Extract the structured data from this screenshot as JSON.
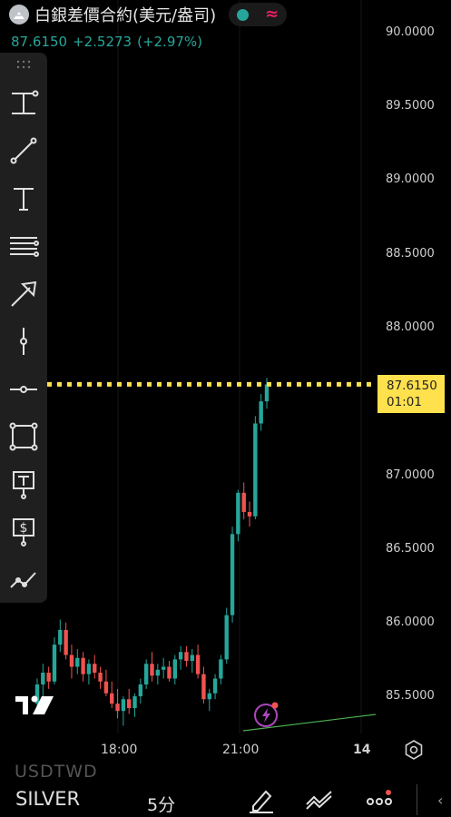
{
  "header": {
    "title": "白銀差價合約(美元/盎司)",
    "symbol_icon": "silver-coin-icon",
    "status_icon": "market-open-dot-icon",
    "status_icon_2": "wave-icon",
    "wave_glyph": "≈"
  },
  "quote": {
    "last": "87.6150",
    "change": "+2.5273",
    "change_pct": "(+2.97%)",
    "color_up": "#26a69a",
    "color_down": "#ef5350"
  },
  "toolbar": {
    "tools": [
      "cross-line-tool-icon",
      "trend-line-icon",
      "text-tool-icon",
      "horizontal-lines-icon",
      "arrow-tool-icon",
      "vertical-line-icon",
      "horizontal-ray-icon",
      "rectangle-tool-icon",
      "text-note-icon",
      "price-label-icon",
      "path-tool-icon"
    ]
  },
  "price_axis": {
    "labels": [
      "90.0000",
      "89.5000",
      "89.0000",
      "88.5000",
      "88.0000",
      "87.0000",
      "86.5000",
      "86.0000",
      "85.5000"
    ],
    "current_price": "87.6150",
    "countdown": "01:01",
    "current_color": "#ffe14d"
  },
  "time_axis": {
    "labels": [
      "18:00",
      "21:00",
      "14"
    ]
  },
  "chart_data": {
    "type": "candlestick",
    "ylim": [
      85.2,
      90.1
    ],
    "x_ticks": [
      "18:00",
      "21:00",
      "14"
    ],
    "last": 87.615,
    "candles": [
      [
        85.45,
        85.62,
        85.38,
        85.58
      ],
      [
        85.58,
        85.72,
        85.5,
        85.66
      ],
      [
        85.66,
        85.7,
        85.55,
        85.6
      ],
      [
        85.6,
        85.9,
        85.58,
        85.85
      ],
      [
        85.85,
        86.02,
        85.8,
        85.95
      ],
      [
        85.95,
        86.0,
        85.75,
        85.78
      ],
      [
        85.78,
        85.85,
        85.62,
        85.7
      ],
      [
        85.7,
        85.82,
        85.65,
        85.76
      ],
      [
        85.76,
        85.8,
        85.6,
        85.65
      ],
      [
        85.65,
        85.75,
        85.58,
        85.72
      ],
      [
        85.72,
        85.78,
        85.62,
        85.66
      ],
      [
        85.66,
        85.7,
        85.55,
        85.6
      ],
      [
        85.6,
        85.68,
        85.5,
        85.52
      ],
      [
        85.52,
        85.6,
        85.42,
        85.45
      ],
      [
        85.45,
        85.55,
        85.35,
        85.4
      ],
      [
        85.4,
        85.5,
        85.3,
        85.48
      ],
      [
        85.48,
        85.55,
        85.38,
        85.42
      ],
      [
        85.42,
        85.52,
        85.36,
        85.5
      ],
      [
        85.5,
        85.62,
        85.45,
        85.58
      ],
      [
        85.58,
        85.75,
        85.55,
        85.72
      ],
      [
        85.72,
        85.8,
        85.6,
        85.64
      ],
      [
        85.64,
        85.72,
        85.58,
        85.68
      ],
      [
        85.68,
        85.76,
        85.62,
        85.7
      ],
      [
        85.7,
        85.74,
        85.6,
        85.62
      ],
      [
        85.62,
        85.78,
        85.58,
        85.75
      ],
      [
        85.75,
        85.84,
        85.68,
        85.8
      ],
      [
        85.8,
        85.84,
        85.7,
        85.74
      ],
      [
        85.74,
        85.82,
        85.66,
        85.78
      ],
      [
        85.78,
        85.85,
        85.62,
        85.65
      ],
      [
        85.65,
        85.7,
        85.45,
        85.48
      ],
      [
        85.48,
        85.55,
        85.4,
        85.52
      ],
      [
        85.52,
        85.65,
        85.48,
        85.62
      ],
      [
        85.62,
        85.78,
        85.58,
        85.75
      ],
      [
        85.75,
        86.1,
        85.72,
        86.05
      ],
      [
        86.05,
        86.65,
        86.0,
        86.6
      ],
      [
        86.6,
        86.9,
        86.55,
        86.88
      ],
      [
        86.88,
        86.95,
        86.7,
        86.75
      ],
      [
        86.75,
        86.82,
        86.65,
        86.72
      ],
      [
        86.72,
        87.4,
        86.7,
        87.35
      ],
      [
        87.35,
        87.55,
        87.3,
        87.5
      ],
      [
        87.5,
        87.66,
        87.45,
        87.615
      ]
    ]
  },
  "bottom_bar": {
    "ghost_text": "USDTWD",
    "symbol": "SILVER",
    "interval": "5分",
    "icons": [
      "draw-pen-icon",
      "indicators-icon",
      "more-icon"
    ],
    "chevron": "‹"
  }
}
